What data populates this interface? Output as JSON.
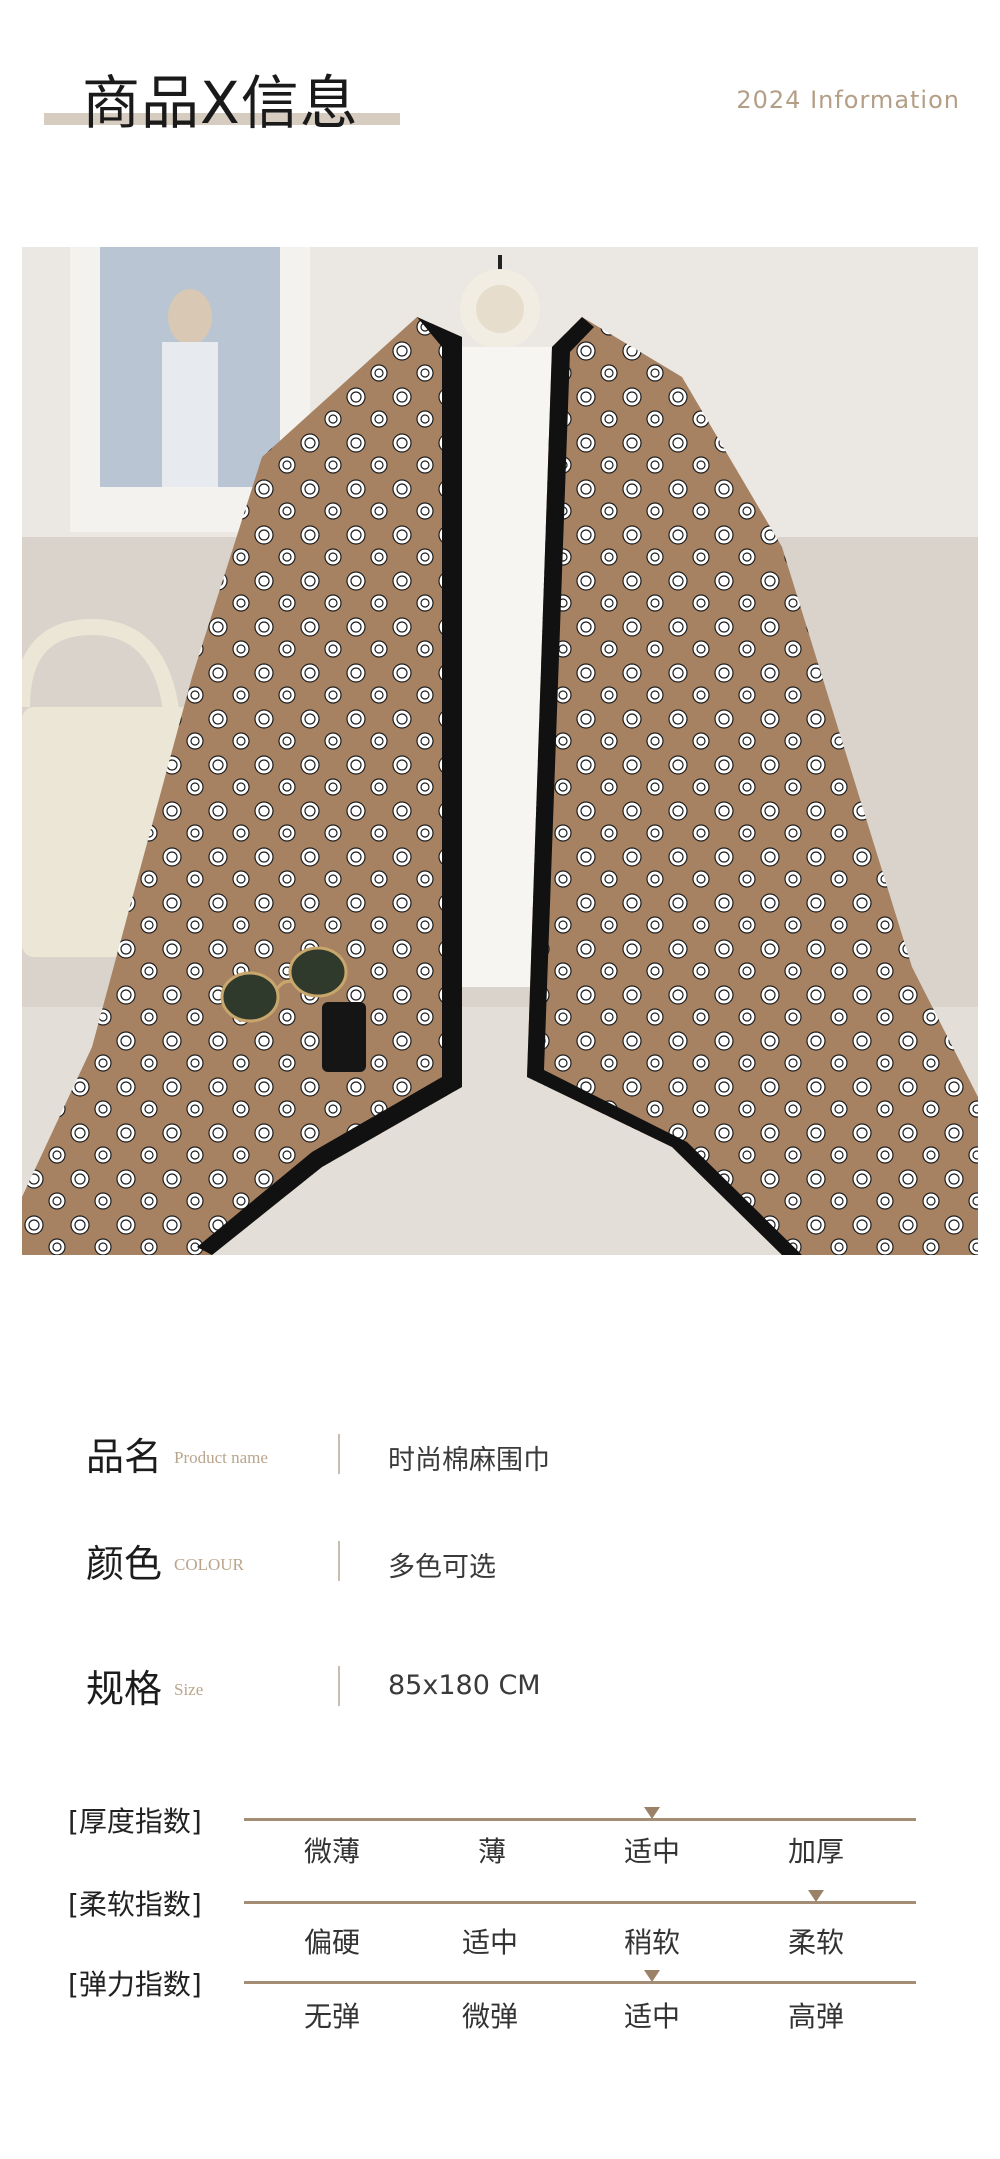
{
  "header": {
    "title": "商品X信息",
    "subtitle": "2024 Information"
  },
  "photo": {
    "description_icon": "scarf-product-photo",
    "scarf_color": "#a68262",
    "border_color": "#111111",
    "flower_color": "#ffffff"
  },
  "info": [
    {
      "cn": "品名",
      "en": "Product name",
      "value": "时尚棉麻围巾"
    },
    {
      "cn": "颜色",
      "en": "COLOUR",
      "value": "多色可选"
    },
    {
      "cn": "规格",
      "en": "Size",
      "value": "85x180 CM"
    }
  ],
  "scales": [
    {
      "label": "[厚度指数]",
      "options": [
        "微薄",
        "薄",
        "适中",
        "加厚"
      ],
      "selected_index": 2
    },
    {
      "label": "[柔软指数]",
      "options": [
        "偏硬",
        "适中",
        "稍软",
        "柔软"
      ],
      "selected_index": 3
    },
    {
      "label": "[弹力指数]",
      "options": [
        "无弹",
        "微弹",
        "适中",
        "高弹"
      ],
      "selected_index": 2
    }
  ]
}
